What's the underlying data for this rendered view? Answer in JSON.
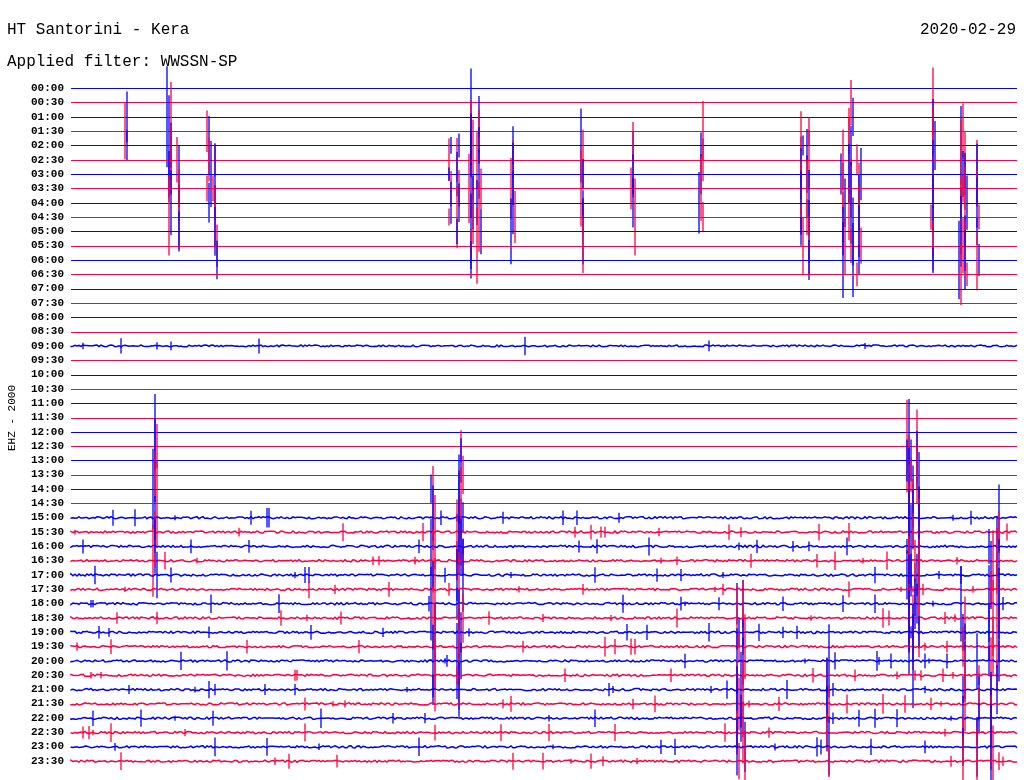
{
  "header": {
    "title": "HT Santorini - Kera",
    "date": "2020-02-29",
    "filter": "Applied filter: WWSSN-SP"
  },
  "channel_label": "EHZ - 2000",
  "traces": [
    {
      "label": "00:00",
      "color": "#0000ff"
    },
    {
      "label": "00:30",
      "color": "#ff0040"
    },
    {
      "label": "01:00",
      "color": "#0000ff"
    },
    {
      "label": "01:30",
      "color": "#ff0040"
    },
    {
      "label": "02:00",
      "color": "#0000ff"
    },
    {
      "label": "02:30",
      "color": "#ff0040"
    },
    {
      "label": "03:00",
      "color": "#0000ff"
    },
    {
      "label": "03:30",
      "color": "#ff0040"
    },
    {
      "label": "04:00",
      "color": "#0000ff"
    },
    {
      "label": "04:30",
      "color": "#ff0040"
    },
    {
      "label": "05:00",
      "color": "#0000ff"
    },
    {
      "label": "05:30",
      "color": "#ff0040"
    },
    {
      "label": "06:00",
      "color": "#0000ff"
    },
    {
      "label": "06:30",
      "color": "#ff0040"
    },
    {
      "label": "07:00",
      "color": "#0000ff"
    },
    {
      "label": "07:30",
      "color": "#ff0040"
    },
    {
      "label": "08:00",
      "color": "#0000ff"
    },
    {
      "label": "08:30",
      "color": "#ff0040"
    },
    {
      "label": "09:00",
      "color": "#0000ff"
    },
    {
      "label": "09:30",
      "color": "#ff0040"
    },
    {
      "label": "10:00",
      "color": "#0000ff"
    },
    {
      "label": "10:30",
      "color": "#ff0040"
    },
    {
      "label": "11:00",
      "color": "#0000ff"
    },
    {
      "label": "11:30",
      "color": "#ff0040"
    },
    {
      "label": "12:00",
      "color": "#0000ff"
    },
    {
      "label": "12:30",
      "color": "#ff0040"
    },
    {
      "label": "13:00",
      "color": "#0000ff"
    },
    {
      "label": "13:30",
      "color": "#ff0040"
    },
    {
      "label": "14:00",
      "color": "#0000ff"
    },
    {
      "label": "14:30",
      "color": "#ff0040"
    },
    {
      "label": "15:00",
      "color": "#0000ff"
    },
    {
      "label": "15:30",
      "color": "#ff0040"
    },
    {
      "label": "16:00",
      "color": "#0000ff"
    },
    {
      "label": "16:30",
      "color": "#ff0040"
    },
    {
      "label": "17:00",
      "color": "#0000ff"
    },
    {
      "label": "17:30",
      "color": "#ff0040"
    },
    {
      "label": "18:00",
      "color": "#0000ff"
    },
    {
      "label": "18:30",
      "color": "#ff0040"
    },
    {
      "label": "19:00",
      "color": "#0000ff"
    },
    {
      "label": "19:30",
      "color": "#ff0040"
    },
    {
      "label": "20:00",
      "color": "#0000ff"
    },
    {
      "label": "20:30",
      "color": "#ff0040"
    },
    {
      "label": "21:00",
      "color": "#0000ff"
    },
    {
      "label": "21:30",
      "color": "#ff0040"
    },
    {
      "label": "22:00",
      "color": "#0000ff"
    },
    {
      "label": "22:30",
      "color": "#ff0040"
    },
    {
      "label": "23:00",
      "color": "#0000ff"
    },
    {
      "label": "23:30",
      "color": "#ff0040"
    }
  ]
}
